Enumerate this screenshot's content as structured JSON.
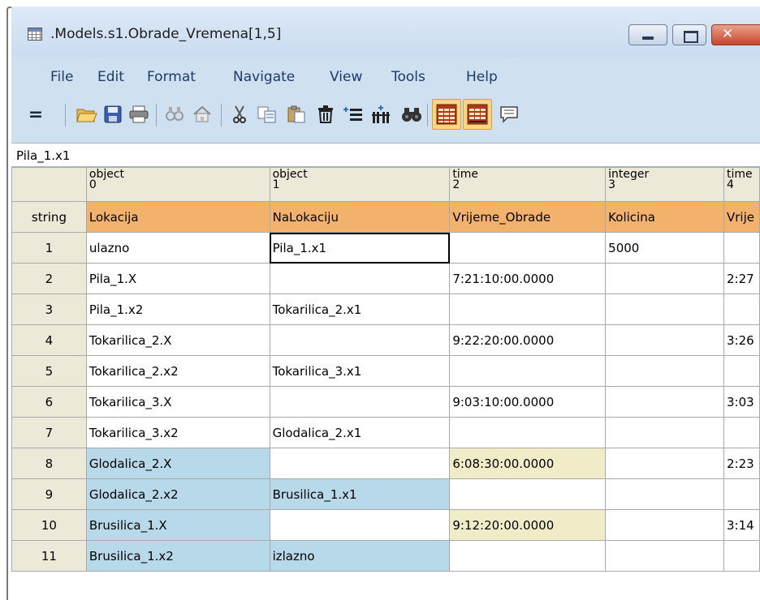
{
  "window": {
    "title": ".Models.s1.Obrade_Vremena[1,5]"
  },
  "menu": {
    "file": "File",
    "edit": "Edit",
    "format": "Format",
    "navigate": "Navigate",
    "view": "View",
    "tools": "Tools",
    "help": "Help"
  },
  "toolbar": {
    "formula_symbol": "=",
    "icons": [
      "open-folder-icon",
      "save-icon",
      "print-icon",
      "find-icon",
      "home-icon",
      "cut-icon",
      "copy-icon",
      "paste-icon",
      "delete-icon",
      "insert-row-icon",
      "insert-column-icon",
      "binoculars-icon",
      "table-view-icon",
      "table-format-icon",
      "comment-icon"
    ]
  },
  "formula": {
    "current_cell": "Pila_1.x1"
  },
  "table": {
    "columns": [
      {
        "type": "object",
        "index": "0",
        "name": "Lokacija"
      },
      {
        "type": "object",
        "index": "1",
        "name": "NaLokaciju"
      },
      {
        "type": "time",
        "index": "2",
        "name": "Vrijeme_Obrade"
      },
      {
        "type": "integer",
        "index": "3",
        "name": "Kolicina"
      },
      {
        "type": "time",
        "index": "4",
        "name": "Vrije"
      }
    ],
    "row_header_type": "string",
    "rows": [
      {
        "num": "1",
        "c0": "ulazno",
        "c1": "Pila_1.x1",
        "c2": "",
        "c3": "5000",
        "c4": ""
      },
      {
        "num": "2",
        "c0": "Pila_1.X",
        "c1": "",
        "c2": "7:21:10:00.0000",
        "c3": "",
        "c4": "2:27"
      },
      {
        "num": "3",
        "c0": "Pila_1.x2",
        "c1": "Tokarilica_2.x1",
        "c2": "",
        "c3": "",
        "c4": ""
      },
      {
        "num": "4",
        "c0": "Tokarilica_2.X",
        "c1": "",
        "c2": "9:22:20:00.0000",
        "c3": "",
        "c4": "3:26"
      },
      {
        "num": "5",
        "c0": "Tokarilica_2.x2",
        "c1": "Tokarilica_3.x1",
        "c2": "",
        "c3": "",
        "c4": ""
      },
      {
        "num": "6",
        "c0": "Tokarilica_3.X",
        "c1": "",
        "c2": "9:03:10:00.0000",
        "c3": "",
        "c4": "3:03"
      },
      {
        "num": "7",
        "c0": "Tokarilica_3.x2",
        "c1": "Glodalica_2.x1",
        "c2": "",
        "c3": "",
        "c4": ""
      },
      {
        "num": "8",
        "c0": "Glodalica_2.X",
        "c1": "",
        "c2": "6:08:30:00.0000",
        "c3": "",
        "c4": "2:23"
      },
      {
        "num": "9",
        "c0": "Glodalica_2.x2",
        "c1": "Brusilica_1.x1",
        "c2": "",
        "c3": "",
        "c4": ""
      },
      {
        "num": "10",
        "c0": "Brusilica_1.X",
        "c1": "",
        "c2": "9:12:20:00.0000",
        "c3": "",
        "c4": "3:14"
      },
      {
        "num": "11",
        "c0": "Brusilica_1.x2",
        "c1": "izlazno",
        "c2": "",
        "c3": "",
        "c4": ""
      }
    ]
  },
  "colors": {
    "header_orange": "#f2b26b",
    "highlight_blue": "#b8d9ea",
    "highlight_cream": "#f0ecc8",
    "frame_blue": "#cfe0f1"
  }
}
